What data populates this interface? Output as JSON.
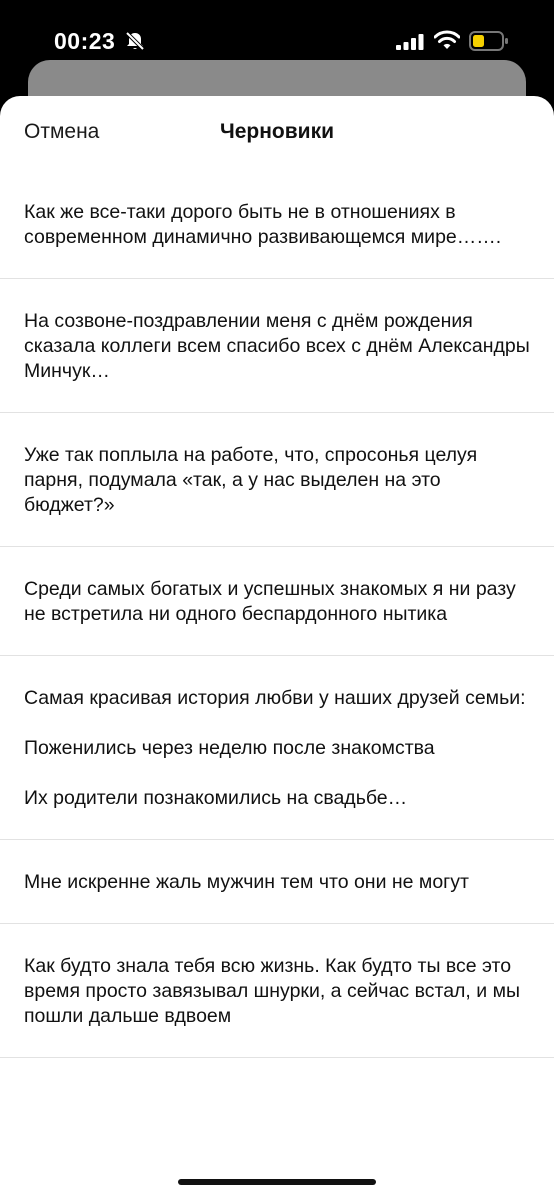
{
  "status_bar": {
    "time": "00:23",
    "icons": [
      "bell-slash-icon",
      "signal-icon",
      "wifi-icon",
      "battery-icon"
    ],
    "battery_color": "#f5d000"
  },
  "header": {
    "cancel_label": "Отмена",
    "title": "Черновики"
  },
  "drafts": [
    {
      "text": "Как же все-таки дорого быть не в отношениях в современном динамично развивающемся мире……."
    },
    {
      "text": "На созвоне-поздравлении меня с днём рождения сказала коллеги всем спасибо всех с днём Александры Минчук…"
    },
    {
      "text": "Уже так поплыла на работе, что, спросонья целуя парня, подумала «так, а у нас выделен на это бюджет?»"
    },
    {
      "text": "Среди самых богатых и успешных знакомых я ни разу не встретила ни одного беспардонного нытика"
    },
    {
      "text": "Самая красивая история любви у наших друзей семьи:\n\nПоженились через неделю после знакомства\n\nИх родители познакомились на свадьбе…"
    },
    {
      "text": "Мне искренне жаль мужчин тем что они не могут"
    },
    {
      "text": "Как будто знала тебя всю жизнь. Как будто ты все это время просто завязывал шнурки, а сейчас встал, и мы пошли дальше вдвоем"
    }
  ]
}
